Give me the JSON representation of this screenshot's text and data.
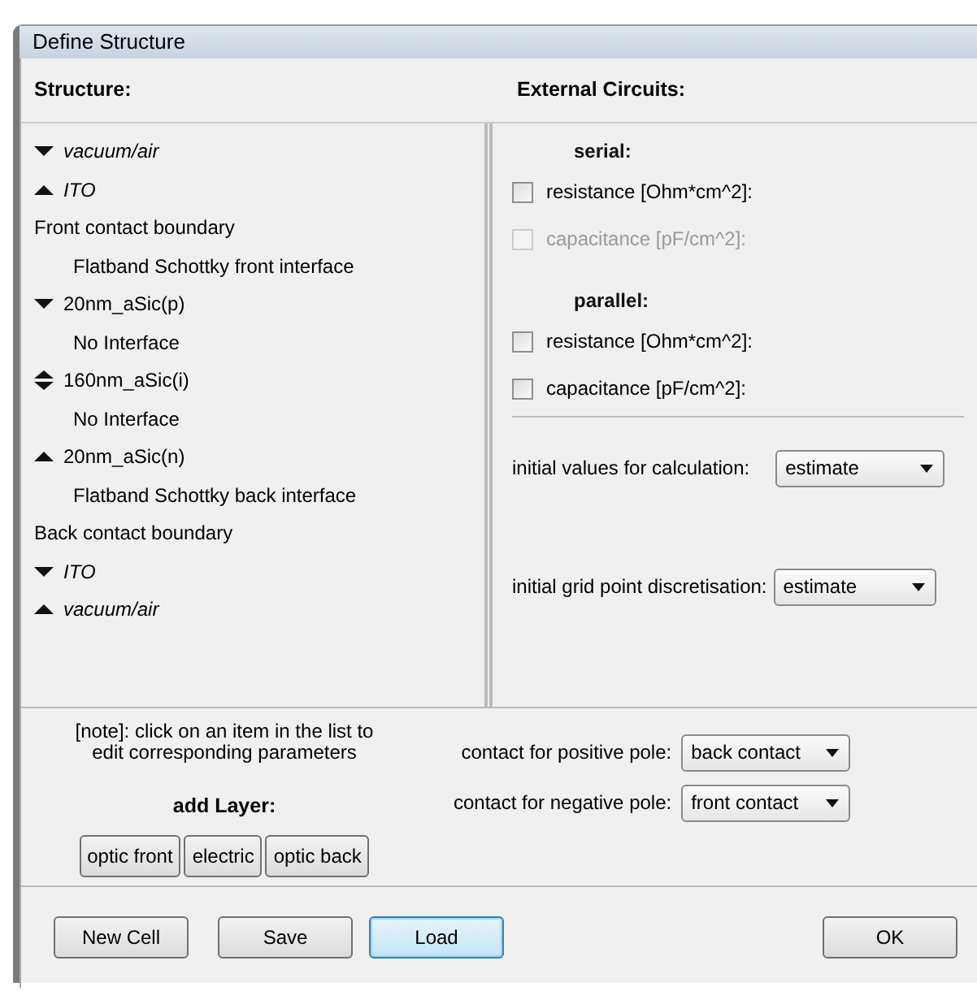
{
  "window": {
    "title": "Define Structure"
  },
  "structure": {
    "heading": "Structure:",
    "items": [
      {
        "kind": "layer",
        "optic": true,
        "arrow_up": false,
        "arrow_down": true,
        "label": "vacuum/air"
      },
      {
        "kind": "layer",
        "optic": true,
        "arrow_up": true,
        "arrow_down": false,
        "label": "ITO"
      },
      {
        "kind": "boundary",
        "label": "Front contact boundary"
      },
      {
        "kind": "interface",
        "label": "Flatband Schottky front interface"
      },
      {
        "kind": "layer",
        "optic": false,
        "arrow_up": false,
        "arrow_down": true,
        "label": "20nm_aSic(p)"
      },
      {
        "kind": "interface",
        "label": "No Interface"
      },
      {
        "kind": "layer",
        "optic": false,
        "arrow_up": true,
        "arrow_down": true,
        "label": "160nm_aSic(i)"
      },
      {
        "kind": "interface",
        "label": "No Interface"
      },
      {
        "kind": "layer",
        "optic": false,
        "arrow_up": true,
        "arrow_down": false,
        "label": "20nm_aSic(n)"
      },
      {
        "kind": "interface",
        "label": "Flatband Schottky back interface"
      },
      {
        "kind": "boundary",
        "label": "Back contact boundary"
      },
      {
        "kind": "layer",
        "optic": true,
        "arrow_up": false,
        "arrow_down": true,
        "label": "ITO"
      },
      {
        "kind": "layer",
        "optic": true,
        "arrow_up": true,
        "arrow_down": false,
        "label": "vacuum/air"
      }
    ]
  },
  "external_circuits": {
    "heading": "External Circuits:",
    "groups": [
      {
        "label": "serial:",
        "options": [
          {
            "label": "resistance [Ohm*cm^2]:",
            "checked": false,
            "disabled": false
          },
          {
            "label": "capacitance [pF/cm^2]:",
            "checked": false,
            "disabled": true
          }
        ]
      },
      {
        "label": "parallel:",
        "options": [
          {
            "label": "resistance [Ohm*cm^2]:",
            "checked": false,
            "disabled": false
          },
          {
            "label": "capacitance [pF/cm^2]:",
            "checked": false,
            "disabled": false
          }
        ]
      }
    ],
    "settings": [
      {
        "label": "initial values for calculation:",
        "value": "estimate"
      },
      {
        "label": "initial grid point discretisation:",
        "value": "estimate"
      }
    ]
  },
  "note": "[note]: click on an item in the list to edit corresponding parameters",
  "add_layer": {
    "label": "add Layer:",
    "buttons": [
      "optic front",
      "electric",
      "optic back"
    ]
  },
  "contacts": [
    {
      "label": "contact for positive pole:",
      "value": "back contact"
    },
    {
      "label": "contact for negative pole:",
      "value": "front contact"
    }
  ],
  "buttons": [
    {
      "label": "New Cell",
      "focused": false
    },
    {
      "label": "Save",
      "focused": false
    },
    {
      "label": "Load",
      "focused": true
    },
    {
      "label": "OK",
      "focused": false
    }
  ]
}
